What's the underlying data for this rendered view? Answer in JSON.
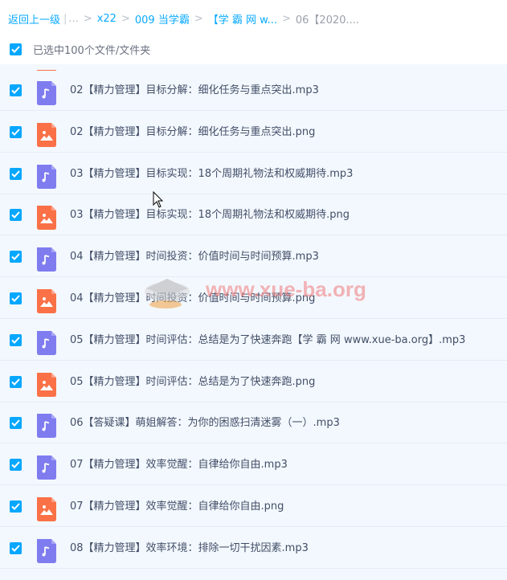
{
  "breadcrumb": {
    "back": "返回上一级",
    "ellipsis": "...",
    "items": [
      "x22",
      "009 当学霸",
      "【学 霸 网 w...",
      "06【2020...."
    ]
  },
  "selection": {
    "label": "已选中100个文件/文件夹"
  },
  "files": [
    {
      "type": "audio",
      "name": "02【精力管理】目标分解：细化任务与重点突出.mp3"
    },
    {
      "type": "image",
      "name": "02【精力管理】目标分解：细化任务与重点突出.png"
    },
    {
      "type": "audio",
      "name": "03【精力管理】目标实现：18个周期礼物法和权威期待.mp3"
    },
    {
      "type": "image",
      "name": "03【精力管理】目标实现：18个周期礼物法和权威期待.png"
    },
    {
      "type": "audio",
      "name": "04【精力管理】时间投资：价值时间与时间预算.mp3"
    },
    {
      "type": "image",
      "name": "04【精力管理】时间投资：价值时间与时间预算.png"
    },
    {
      "type": "audio",
      "name": "05【精力管理】时间评估：总结是为了快速奔跑【学 霸 网 www.xue-ba.org】.mp3"
    },
    {
      "type": "image",
      "name": "05【精力管理】时间评估：总结是为了快速奔跑.png"
    },
    {
      "type": "audio",
      "name": "06【答疑课】萌姐解答：为你的困惑扫清迷雾（一）.mp3"
    },
    {
      "type": "audio",
      "name": "07【精力管理】效率觉醒：自律给你自由.mp3"
    },
    {
      "type": "image",
      "name": "07【精力管理】效率觉醒：自律给你自由.png"
    },
    {
      "type": "audio",
      "name": "08【精力管理】效率环境：排除一切干扰因素.mp3"
    }
  ],
  "watermark": {
    "text": "www.xue-ba.org"
  },
  "colors": {
    "accent": "#06a7ff",
    "audio_icon": "#7f7cf0",
    "image_icon": "#fa7147",
    "row_bg": "#f3f8fe"
  }
}
